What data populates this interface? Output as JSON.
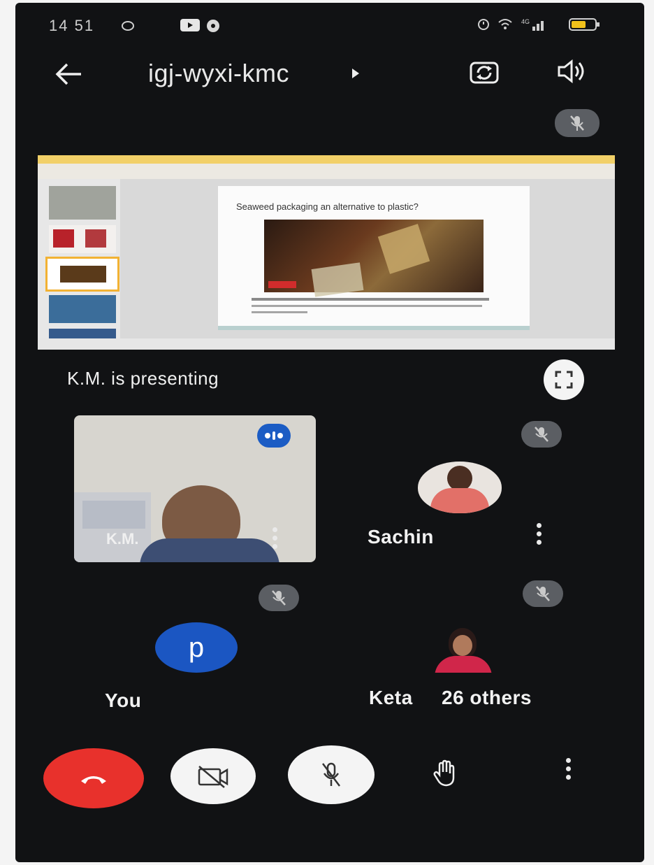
{
  "status_bar": {
    "time": "14 51",
    "right_text": "4G",
    "battery_level": 0.6
  },
  "header": {
    "meeting_code": "igj-wyxi-kmc",
    "accent": "#1a73e8"
  },
  "presentation": {
    "caption": "K.M. is presenting",
    "slide_title": "Seaweed packaging an alternative to plastic?"
  },
  "participants": {
    "km": {
      "name": "K.M."
    },
    "sachin": {
      "name": "Sachin"
    },
    "you": {
      "name": "You",
      "initial": "p",
      "avatar_color": "#1b56c2"
    },
    "keta": {
      "name": "Keta",
      "others": "26 others"
    }
  },
  "controls": {
    "end_call_color": "#e8312c",
    "items": [
      "end-call",
      "camera-off",
      "mic-off",
      "raise-hand",
      "more"
    ]
  }
}
